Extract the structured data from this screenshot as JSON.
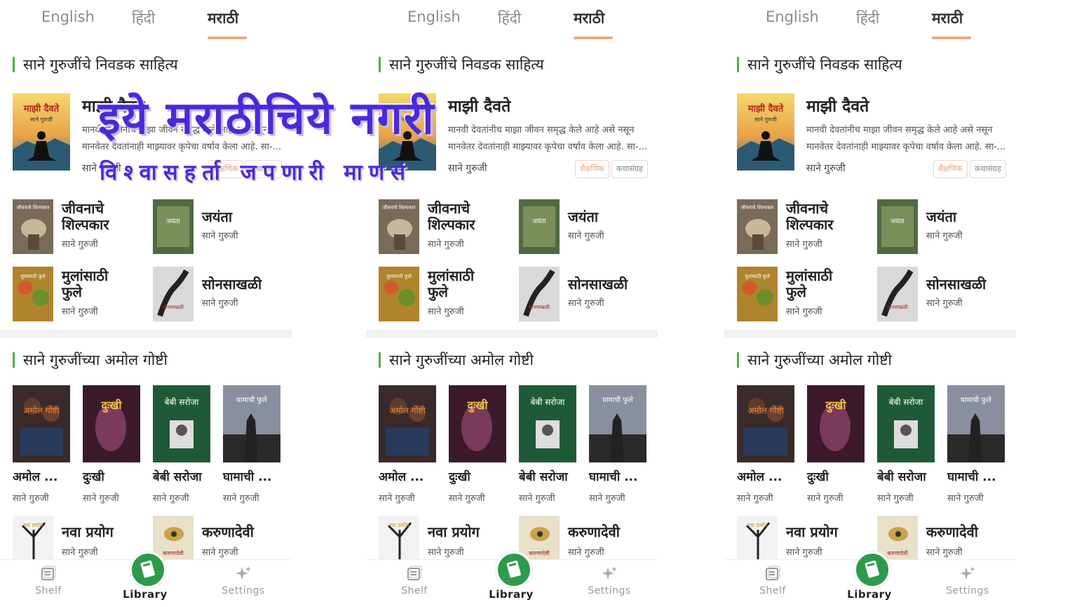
{
  "tabs": [
    "English",
    "हिंदी",
    "मराठी"
  ],
  "active_tab": "मराठी",
  "section1_title": "साने गुरुजींचे निवडक साहित्य",
  "featured": {
    "title": "माझी दैवते",
    "desc_line1": "मानवी देवतांनीच माझा जीवन समृद्ध केले आहे असे नसून",
    "desc_line2": "मानवेतर देवतांनाही माझ्यावर कृपेचा वर्षाव केला आहे. सा-...",
    "author": "साने गुरुजी",
    "chips": [
      "शैक्षणिक",
      "कथासंग्रह"
    ],
    "cover_title": "माझी दैवते",
    "cover_author": "साने गुरुजी"
  },
  "grid_books": [
    {
      "title_line1": "जीवनाचे",
      "title_line2": "शिल्पकार",
      "author": "साने गुरुजी",
      "cover_text": "जीवनाचे शिल्पकार"
    },
    {
      "title_line1": "जयंता",
      "title_line2": "",
      "author": "साने गुरुजी",
      "cover_text": "जयंता"
    },
    {
      "title_line1": "मुलांसाठी",
      "title_line2": "फुले",
      "author": "साने गुरुजी",
      "cover_text": "मुलांसाठी फुले"
    },
    {
      "title_line1": "सोनसाखळी",
      "title_line2": "",
      "author": "साने गुरुजी",
      "cover_text": "सोनसाखळी"
    }
  ],
  "section2_title": "साने गुरुजींच्या अमोल गोष्टी",
  "row_books": [
    {
      "title": "अमोल ...",
      "author": "साने गुरुजी",
      "cover_text": "अमोल गोष्टी"
    },
    {
      "title": "दुःखी",
      "author": "साने गुरुजी",
      "cover_text": "दुःखी"
    },
    {
      "title": "बेबी सरोजा",
      "author": "साने गुरुजी",
      "cover_text": "बेबी सरोजा"
    },
    {
      "title": "घामाची ...",
      "author": "साने गुरुजी",
      "cover_text": "घामाची फुले"
    }
  ],
  "bottom_books": [
    {
      "title": "नवा प्रयोग",
      "author": "साने गुरुजी",
      "cover_text": "नवा प्रयोग"
    },
    {
      "title": "करुणादेवी",
      "author": "साने गुरुजी",
      "cover_text": "करुणादेवी"
    }
  ],
  "nav": {
    "shelf": "Shelf",
    "library": "Library",
    "settings": "Settings"
  },
  "overlay": {
    "title": "इये मराठीचिये नगरी",
    "subtitle": "विश्वासहर्ता जपणारी माणसं"
  },
  "colors": {
    "accent_green": "#2e9a4c",
    "tab_underline": "#f0a982",
    "overlay_text": "#4a2ad6"
  },
  "icons": [
    "shelf-icon",
    "library-book-icon",
    "settings-sparkle-icon"
  ]
}
